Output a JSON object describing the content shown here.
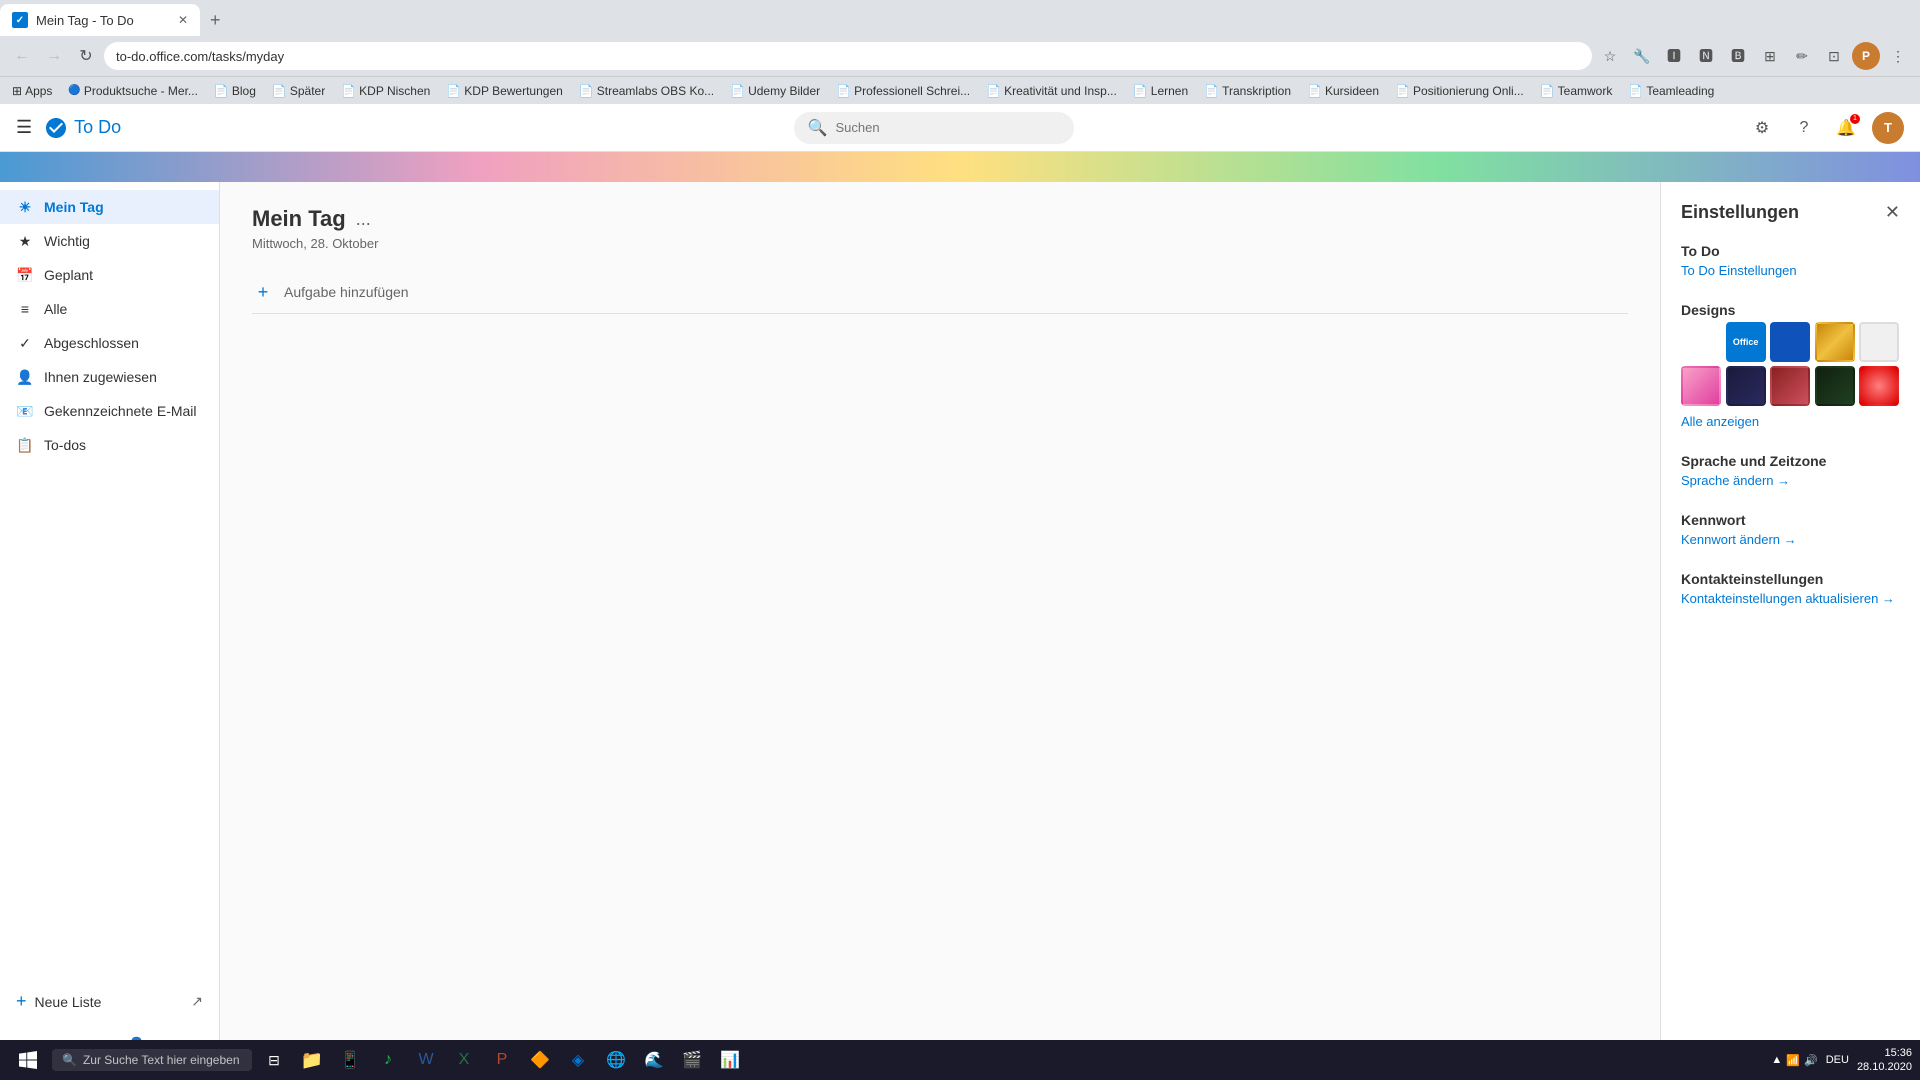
{
  "browser": {
    "tab_title": "Mein Tag - To Do",
    "url": "to-do.office.com/tasks/myday",
    "new_tab_label": "+",
    "nav": {
      "back": "←",
      "forward": "→",
      "refresh": "↻"
    }
  },
  "bookmarks": [
    {
      "label": "Apps",
      "icon": "⊞"
    },
    {
      "label": "Produktsuche - Mer...",
      "icon": "🔵"
    },
    {
      "label": "Blog",
      "icon": "📄"
    },
    {
      "label": "Später",
      "icon": "📄"
    },
    {
      "label": "KDP Nischen",
      "icon": "📄"
    },
    {
      "label": "KDP Bewertungen",
      "icon": "📄"
    },
    {
      "label": "Streamlabs OBS Ko...",
      "icon": "📄"
    },
    {
      "label": "Udemy Bilder",
      "icon": "📄"
    },
    {
      "label": "Professionell Schrei...",
      "icon": "📄"
    },
    {
      "label": "Kreativität und Insp...",
      "icon": "📄"
    },
    {
      "label": "Lernen",
      "icon": "📄"
    },
    {
      "label": "Transkription",
      "icon": "📄"
    },
    {
      "label": "Kursideen",
      "icon": "📄"
    },
    {
      "label": "Positionierung Onli...",
      "icon": "📄"
    },
    {
      "label": "Teamwork",
      "icon": "📄"
    },
    {
      "label": "Teamleading",
      "icon": "📄"
    }
  ],
  "app": {
    "logo_text": "To Do",
    "search_placeholder": "Suchen",
    "header_icons": {
      "settings": "⚙",
      "help": "?",
      "notification": "🔔",
      "user_initials": "T"
    }
  },
  "sidebar": {
    "items": [
      {
        "label": "Mein Tag",
        "icon": "☀",
        "active": true
      },
      {
        "label": "Wichtig",
        "icon": "★",
        "active": false
      },
      {
        "label": "Geplant",
        "icon": "📅",
        "active": false
      },
      {
        "label": "Alle",
        "icon": "≡",
        "active": false
      },
      {
        "label": "Abgeschlossen",
        "icon": "✓",
        "active": false
      },
      {
        "label": "Ihnen zugewiesen",
        "icon": "👤",
        "active": false
      },
      {
        "label": "Gekennzeichnete E-Mail",
        "icon": "📧",
        "active": false
      },
      {
        "label": "To-dos",
        "icon": "📋",
        "active": false
      }
    ],
    "new_list_label": "Neue Liste",
    "new_list_icon": "↗",
    "footer_icons": [
      "✉",
      "⊞",
      "👤",
      "✓"
    ]
  },
  "main": {
    "page_title": "Mein Tag",
    "more_icon": "...",
    "page_date": "Mittwoch, 28. Oktober",
    "add_task_label": "Aufgabe hinzufügen",
    "add_task_icon": "+"
  },
  "settings_panel": {
    "title": "Einstellungen",
    "close_icon": "✕",
    "todo_section": {
      "title": "To Do",
      "sub_label": "To Do Einstellungen"
    },
    "designs_section": {
      "title": "Designs",
      "show_all_label": "Alle anzeigen",
      "designs": [
        {
          "name": "circuit",
          "label": "",
          "class": "pattern-circuit"
        },
        {
          "name": "office",
          "label": "Office",
          "class": "pattern-office",
          "selected": true
        },
        {
          "name": "blue-solid",
          "label": "",
          "class": "pattern-blue-solid"
        },
        {
          "name": "gold",
          "label": "",
          "class": "pattern-gold"
        },
        {
          "name": "white",
          "label": "",
          "class": "pattern-white"
        },
        {
          "name": "pink",
          "label": "",
          "class": "pattern-pink"
        },
        {
          "name": "dark-wave",
          "label": "",
          "class": "pattern-dark-wave"
        },
        {
          "name": "flowers",
          "label": "",
          "class": "pattern-flowers"
        },
        {
          "name": "dark-forest",
          "label": "",
          "class": "pattern-dark-forest"
        },
        {
          "name": "red-gradient",
          "label": "",
          "class": "pattern-red-gradient"
        }
      ]
    },
    "language_section": {
      "title": "Sprache und Zeitzone",
      "link_label": "Sprache ändern →"
    },
    "password_section": {
      "title": "Kennwort",
      "link_label": "Kennwort ändern →"
    },
    "contact_section": {
      "title": "Kontakteinstellungen",
      "link_label": "Kontakteinstellungen aktualisieren →"
    }
  },
  "taskbar": {
    "search_placeholder": "Zur Suche Text hier eingeben",
    "time": "15:36",
    "date": "28.10.2020",
    "language": "DEU"
  }
}
